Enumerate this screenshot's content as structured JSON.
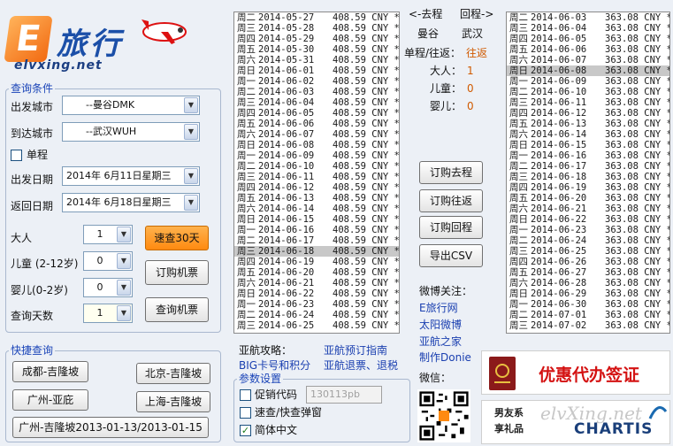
{
  "brand": {
    "logo_letter": "E",
    "name": "旅行",
    "url": "elvxing.net"
  },
  "query": {
    "title": "查询条件",
    "from_label": "出发城市",
    "from_value": "--曼谷DMK",
    "to_label": "到达城市",
    "to_value": "--武汉WUH",
    "oneway_label": "单程",
    "oneway_checked": false,
    "depart_label": "出发日期",
    "depart_value": "2014年 6月11日星期三",
    "return_label": "返回日期",
    "return_value": "2014年 6月18日星期三",
    "adult_label": "大人",
    "adult_value": "1",
    "child_label": "儿童 (2-12岁)",
    "child_value": "0",
    "infant_label": "婴儿(0-2岁)",
    "infant_value": "0",
    "days_label": "查询天数",
    "days_value": "1",
    "fast_button": "速查30天",
    "order_button": "订购机票",
    "search_button": "查询机票"
  },
  "quick": {
    "title": "快捷查询",
    "buttons": [
      "成都-吉隆坡",
      "北京-吉隆坡",
      "广州-亚庇",
      "上海-吉隆坡",
      "广州-吉隆坡2013-01-13/2013-01-15"
    ]
  },
  "outbound_list": [
    {
      "day": "周二",
      "date": "2014-05-27",
      "price": "408.59 CNY *"
    },
    {
      "day": "周三",
      "date": "2014-05-28",
      "price": "408.59 CNY *"
    },
    {
      "day": "周四",
      "date": "2014-05-29",
      "price": "408.59 CNY *"
    },
    {
      "day": "周五",
      "date": "2014-05-30",
      "price": "408.59 CNY *"
    },
    {
      "day": "周六",
      "date": "2014-05-31",
      "price": "408.59 CNY *"
    },
    {
      "day": "周日",
      "date": "2014-06-01",
      "price": "408.59 CNY *"
    },
    {
      "day": "周一",
      "date": "2014-06-02",
      "price": "408.59 CNY *"
    },
    {
      "day": "周二",
      "date": "2014-06-03",
      "price": "408.59 CNY *"
    },
    {
      "day": "周三",
      "date": "2014-06-04",
      "price": "408.59 CNY *"
    },
    {
      "day": "周四",
      "date": "2014-06-05",
      "price": "408.59 CNY *"
    },
    {
      "day": "周五",
      "date": "2014-06-06",
      "price": "408.59 CNY *"
    },
    {
      "day": "周六",
      "date": "2014-06-07",
      "price": "408.59 CNY *"
    },
    {
      "day": "周日",
      "date": "2014-06-08",
      "price": "408.59 CNY *"
    },
    {
      "day": "周一",
      "date": "2014-06-09",
      "price": "408.59 CNY *"
    },
    {
      "day": "周二",
      "date": "2014-06-10",
      "price": "408.59 CNY *"
    },
    {
      "day": "周三",
      "date": "2014-06-11",
      "price": "408.59 CNY *"
    },
    {
      "day": "周四",
      "date": "2014-06-12",
      "price": "408.59 CNY *"
    },
    {
      "day": "周五",
      "date": "2014-06-13",
      "price": "408.59 CNY *"
    },
    {
      "day": "周六",
      "date": "2014-06-14",
      "price": "408.59 CNY *"
    },
    {
      "day": "周日",
      "date": "2014-06-15",
      "price": "408.59 CNY *"
    },
    {
      "day": "周一",
      "date": "2014-06-16",
      "price": "408.59 CNY *"
    },
    {
      "day": "周二",
      "date": "2014-06-17",
      "price": "408.59 CNY *"
    },
    {
      "day": "周三",
      "date": "2014-06-18",
      "price": "408.59 CNY *",
      "selected": true
    },
    {
      "day": "周四",
      "date": "2014-06-19",
      "price": "408.59 CNY *"
    },
    {
      "day": "周五",
      "date": "2014-06-20",
      "price": "408.59 CNY *"
    },
    {
      "day": "周六",
      "date": "2014-06-21",
      "price": "408.59 CNY *"
    },
    {
      "day": "周日",
      "date": "2014-06-22",
      "price": "408.59 CNY *"
    },
    {
      "day": "周一",
      "date": "2014-06-23",
      "price": "408.59 CNY *"
    },
    {
      "day": "周二",
      "date": "2014-06-24",
      "price": "408.59 CNY *"
    },
    {
      "day": "周三",
      "date": "2014-06-25",
      "price": "408.59 CNY *"
    }
  ],
  "return_list": [
    {
      "day": "周二",
      "date": "2014-06-03",
      "price": "363.08 CNY *"
    },
    {
      "day": "周三",
      "date": "2014-06-04",
      "price": "363.08 CNY *"
    },
    {
      "day": "周四",
      "date": "2014-06-05",
      "price": "363.08 CNY *"
    },
    {
      "day": "周五",
      "date": "2014-06-06",
      "price": "363.08 CNY *"
    },
    {
      "day": "周六",
      "date": "2014-06-07",
      "price": "363.08 CNY *"
    },
    {
      "day": "周日",
      "date": "2014-06-08",
      "price": "363.08 CNY *",
      "selected": true
    },
    {
      "day": "周一",
      "date": "2014-06-09",
      "price": "363.08 CNY *"
    },
    {
      "day": "周二",
      "date": "2014-06-10",
      "price": "363.08 CNY *"
    },
    {
      "day": "周三",
      "date": "2014-06-11",
      "price": "363.08 CNY *"
    },
    {
      "day": "周四",
      "date": "2014-06-12",
      "price": "363.08 CNY *"
    },
    {
      "day": "周五",
      "date": "2014-06-13",
      "price": "363.08 CNY *"
    },
    {
      "day": "周六",
      "date": "2014-06-14",
      "price": "363.08 CNY *"
    },
    {
      "day": "周日",
      "date": "2014-06-15",
      "price": "363.08 CNY *"
    },
    {
      "day": "周一",
      "date": "2014-06-16",
      "price": "363.08 CNY *"
    },
    {
      "day": "周二",
      "date": "2014-06-17",
      "price": "363.08 CNY *"
    },
    {
      "day": "周三",
      "date": "2014-06-18",
      "price": "363.08 CNY *"
    },
    {
      "day": "周四",
      "date": "2014-06-19",
      "price": "363.08 CNY *"
    },
    {
      "day": "周五",
      "date": "2014-06-20",
      "price": "363.08 CNY *"
    },
    {
      "day": "周六",
      "date": "2014-06-21",
      "price": "363.08 CNY *"
    },
    {
      "day": "周日",
      "date": "2014-06-22",
      "price": "363.08 CNY *"
    },
    {
      "day": "周一",
      "date": "2014-06-23",
      "price": "363.08 CNY *"
    },
    {
      "day": "周二",
      "date": "2014-06-24",
      "price": "363.08 CNY *"
    },
    {
      "day": "周三",
      "date": "2014-06-25",
      "price": "363.08 CNY *"
    },
    {
      "day": "周四",
      "date": "2014-06-26",
      "price": "363.08 CNY *"
    },
    {
      "day": "周五",
      "date": "2014-06-27",
      "price": "363.08 CNY *"
    },
    {
      "day": "周六",
      "date": "2014-06-28",
      "price": "363.08 CNY *"
    },
    {
      "day": "周日",
      "date": "2014-06-29",
      "price": "363.08 CNY *"
    },
    {
      "day": "周一",
      "date": "2014-06-30",
      "price": "363.08 CNY *"
    },
    {
      "day": "周二",
      "date": "2014-07-01",
      "price": "363.08 CNY *"
    },
    {
      "day": "周三",
      "date": "2014-07-02",
      "price": "363.08 CNY *"
    }
  ],
  "summary": {
    "outbound_header": "<-去程",
    "return_header": "回程->",
    "from_city": "曼谷",
    "to_city": "武汉",
    "trip_type_label": "单程/往返：",
    "trip_type_value": "往返",
    "adult_label": "大人：",
    "adult_value": "1",
    "child_label": "儿童：",
    "child_value": "0",
    "infant_label": "婴儿：",
    "infant_value": "0"
  },
  "actions": {
    "book_outbound": "订购去程",
    "book_round": "订购往返",
    "book_return": "订购回程",
    "export_csv": "导出CSV"
  },
  "weibo": {
    "title": "微博关注：",
    "links": [
      "E旅行网",
      "太阳微博",
      "亚航之家",
      "制作Donie"
    ],
    "wechat_label": "微信："
  },
  "airasia": {
    "tips_label": "亚航攻略：",
    "tips_link1": "亚航预订指南",
    "tips_link2": "BIG卡号和积分",
    "tips_link3": "亚航退票、退税"
  },
  "params": {
    "title": "参数设置",
    "promo_label": "促销代码",
    "promo_placeholder": "130113pb",
    "promo_checked": false,
    "popup_label": "速查/快查弹窗",
    "popup_checked": false,
    "simplified_label": "简体中文",
    "simplified_checked": true
  },
  "ads": {
    "visa_text": "优惠代办签证",
    "gift_text": "男友系\n享礼品",
    "gift_brand": "CHARTIS",
    "watermark": "elvXing.net"
  },
  "colors": {
    "accent_orange": "#ff9a1f",
    "link_blue": "#1a3fb0",
    "visa_red": "#d41212"
  }
}
